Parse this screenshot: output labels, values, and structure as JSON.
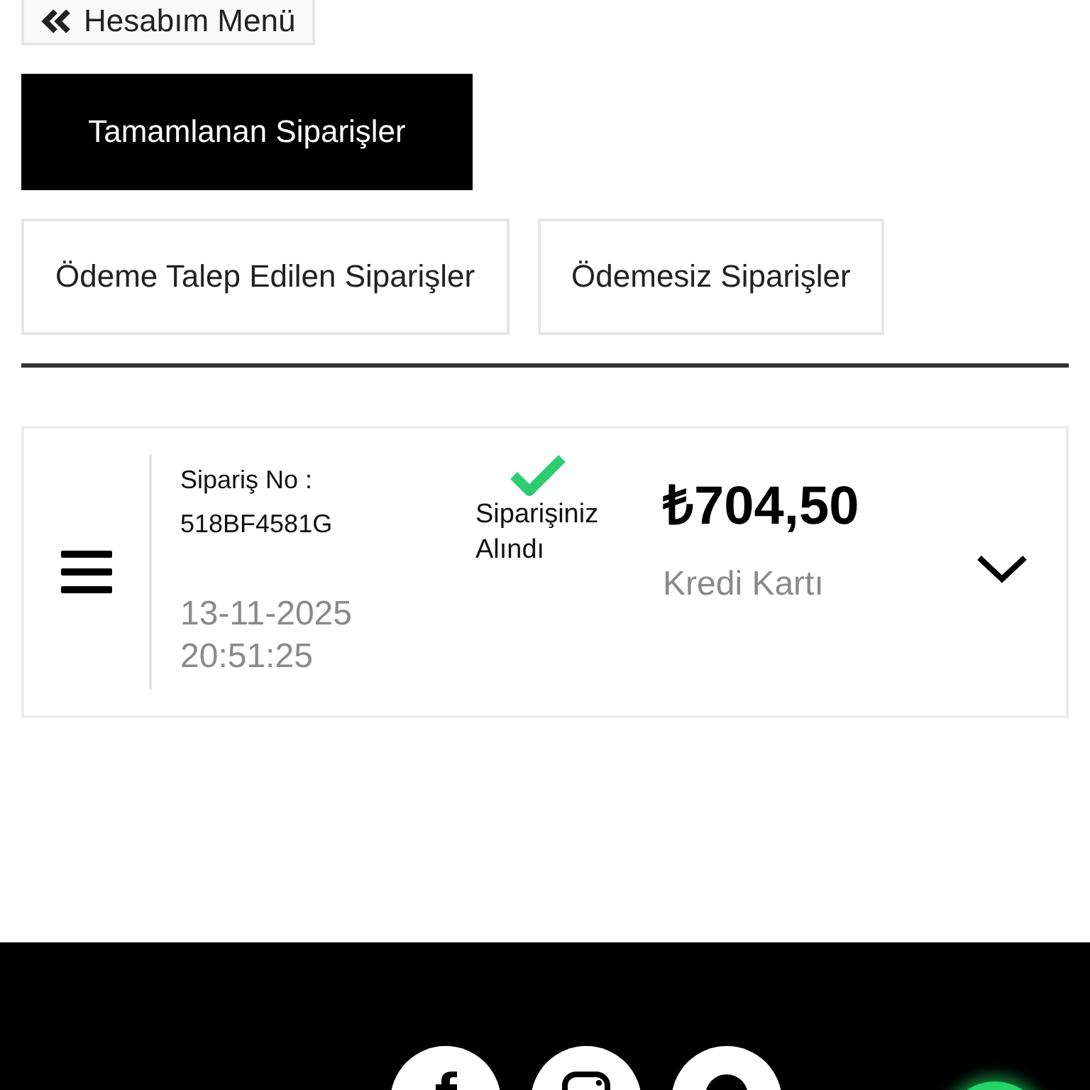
{
  "back_button": {
    "label": "Hesabım Menü"
  },
  "tabs": [
    {
      "label": "Tamamlanan Siparişler",
      "selected": true
    },
    {
      "label": "Ödeme Talep Edilen Siparişler",
      "selected": false
    },
    {
      "label": "Ödemesiz Siparişler",
      "selected": false
    }
  ],
  "orders": [
    {
      "order_no_label": "Sipariş No :",
      "order_no": "518BF4581G",
      "date": "13-11-2025",
      "time": "20:51:25",
      "status": "Siparişiniz Alındı",
      "amount": "₺704,50",
      "payment": "Kredi Kartı"
    }
  ]
}
